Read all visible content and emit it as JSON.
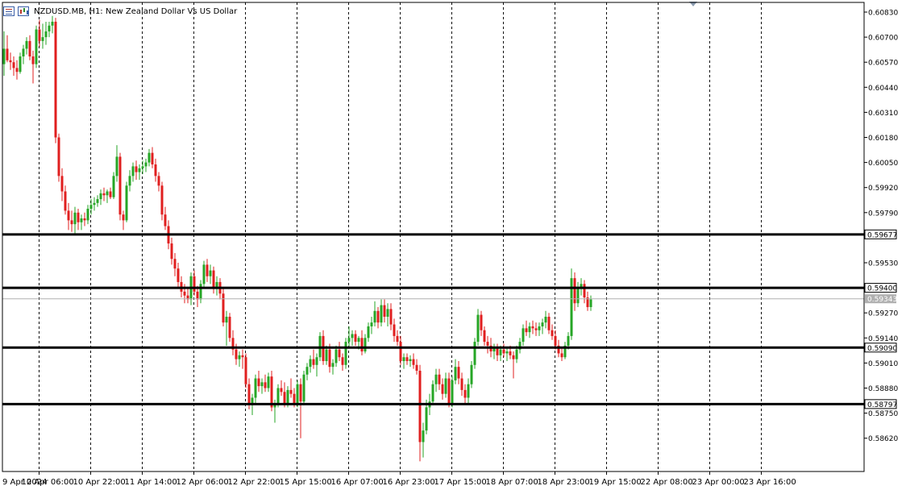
{
  "header": {
    "symbol_line": "NZDUSD.MB, H1:  New Zealand Dollar Vs US Dollar",
    "icons": [
      "list-icon",
      "chart-window-icon"
    ]
  },
  "chart_data": {
    "type": "candlestick",
    "symbol": "NZDUSD.MB",
    "timeframe": "H1",
    "title": "New Zealand Dollar Vs US Dollar",
    "ylim": [
      0.5855,
      0.6089
    ],
    "y_ticks": [
      "0.60830",
      "0.60700",
      "0.60570",
      "0.60440",
      "0.60310",
      "0.60180",
      "0.60050",
      "0.59920",
      "0.59790",
      "0.59530",
      "0.59270",
      "0.59140",
      "0.59010",
      "0.58880",
      "0.58750",
      "0.58620"
    ],
    "x_ticks": [
      "9 Apr 2024",
      "10 Apr 06:00",
      "10 Apr 22:00",
      "11 Apr 14:00",
      "12 Apr 06:00",
      "12 Apr 22:00",
      "15 Apr 15:00",
      "16 Apr 07:00",
      "16 Apr 23:00",
      "17 Apr 15:00",
      "18 Apr 07:00",
      "18 Apr 23:00",
      "19 Apr 15:00",
      "22 Apr 08:00",
      "23 Apr 00:00",
      "23 Apr 16:00"
    ],
    "grid": {
      "vertical_dashed": true,
      "horizontal": false
    },
    "current_price": {
      "value": 0.59343,
      "label": "0.59343"
    },
    "horizontal_levels": [
      {
        "value": 0.59677,
        "label": "0.59677"
      },
      {
        "value": 0.594,
        "label": "0.59400"
      },
      {
        "value": 0.5909,
        "label": "0.59090"
      },
      {
        "value": 0.58797,
        "label": "0.58797"
      }
    ],
    "colors": {
      "bull": "#26a626",
      "bear": "#e01f1f",
      "level": "#000000",
      "current": "#b0b0b0",
      "grid": "#000000"
    },
    "bars_per_tick": 16,
    "candles": [
      [
        0.6056,
        0.6073,
        0.605,
        0.6064
      ],
      [
        0.6064,
        0.6071,
        0.6057,
        0.6058
      ],
      [
        0.6058,
        0.6062,
        0.6053,
        0.6057
      ],
      [
        0.6057,
        0.606,
        0.605,
        0.6054
      ],
      [
        0.6054,
        0.6058,
        0.6048,
        0.6052
      ],
      [
        0.6052,
        0.6062,
        0.6051,
        0.606
      ],
      [
        0.606,
        0.6066,
        0.6056,
        0.6064
      ],
      [
        0.6064,
        0.607,
        0.6061,
        0.6068
      ],
      [
        0.6068,
        0.6071,
        0.6058,
        0.606
      ],
      [
        0.606,
        0.6063,
        0.6046,
        0.6056
      ],
      [
        0.6056,
        0.6076,
        0.6054,
        0.6074
      ],
      [
        0.6074,
        0.6079,
        0.6065,
        0.6068
      ],
      [
        0.6068,
        0.6077,
        0.6064,
        0.607
      ],
      [
        0.607,
        0.6078,
        0.6066,
        0.6073
      ],
      [
        0.6073,
        0.6078,
        0.607,
        0.6076
      ],
      [
        0.6076,
        0.6081,
        0.6072,
        0.6078
      ],
      [
        0.6078,
        0.608,
        0.6015,
        0.6018
      ],
      [
        0.6018,
        0.602,
        0.5995,
        0.5998
      ],
      [
        0.5998,
        0.6002,
        0.5985,
        0.599
      ],
      [
        0.599,
        0.5993,
        0.5978,
        0.598
      ],
      [
        0.598,
        0.5984,
        0.597,
        0.5975
      ],
      [
        0.5975,
        0.598,
        0.5969,
        0.5973
      ],
      [
        0.5973,
        0.5982,
        0.5968,
        0.5979
      ],
      [
        0.5979,
        0.5981,
        0.597,
        0.5974
      ],
      [
        0.5974,
        0.5978,
        0.597,
        0.5976
      ],
      [
        0.5976,
        0.5979,
        0.5972,
        0.5975
      ],
      [
        0.5975,
        0.5983,
        0.5973,
        0.5981
      ],
      [
        0.5981,
        0.5986,
        0.5978,
        0.5983
      ],
      [
        0.5983,
        0.5987,
        0.598,
        0.5984
      ],
      [
        0.5984,
        0.5988,
        0.5982,
        0.5986
      ],
      [
        0.5986,
        0.5991,
        0.5983,
        0.5989
      ],
      [
        0.5989,
        0.5992,
        0.5985,
        0.5988
      ],
      [
        0.5988,
        0.5991,
        0.5984,
        0.599
      ],
      [
        0.599,
        0.5992,
        0.5986,
        0.5987
      ],
      [
        0.5987,
        0.6,
        0.5986,
        0.5998
      ],
      [
        0.5998,
        0.6014,
        0.5995,
        0.6008
      ],
      [
        0.6008,
        0.601,
        0.5975,
        0.5978
      ],
      [
        0.5978,
        0.598,
        0.597,
        0.5975
      ],
      [
        0.5975,
        0.5995,
        0.5974,
        0.5993
      ],
      [
        0.5993,
        0.6001,
        0.599,
        0.5998
      ],
      [
        0.5998,
        0.6005,
        0.5995,
        0.6003
      ],
      [
        0.6003,
        0.6006,
        0.5996,
        0.6
      ],
      [
        0.6,
        0.6004,
        0.5996,
        0.6002
      ],
      [
        0.6002,
        0.6006,
        0.5999,
        0.6003
      ],
      [
        0.6003,
        0.6007,
        0.6,
        0.6005
      ],
      [
        0.6005,
        0.6012,
        0.6003,
        0.601
      ],
      [
        0.601,
        0.6013,
        0.6002,
        0.6004
      ],
      [
        0.6004,
        0.6007,
        0.5995,
        0.5998
      ],
      [
        0.5998,
        0.6,
        0.599,
        0.5993
      ],
      [
        0.5993,
        0.5995,
        0.5975,
        0.5978
      ],
      [
        0.5978,
        0.5982,
        0.597,
        0.5972
      ],
      [
        0.5972,
        0.5975,
        0.596,
        0.5963
      ],
      [
        0.5963,
        0.5966,
        0.5952,
        0.5955
      ],
      [
        0.5955,
        0.5958,
        0.5946,
        0.595
      ],
      [
        0.595,
        0.5953,
        0.594,
        0.5943
      ],
      [
        0.5943,
        0.5946,
        0.5935,
        0.5938
      ],
      [
        0.5938,
        0.5942,
        0.5932,
        0.5936
      ],
      [
        0.5936,
        0.594,
        0.5932,
        0.5934
      ],
      [
        0.5934,
        0.5948,
        0.5931,
        0.5946
      ],
      [
        0.5946,
        0.5949,
        0.5936,
        0.5938
      ],
      [
        0.5938,
        0.5941,
        0.593,
        0.5934
      ],
      [
        0.5934,
        0.5944,
        0.5932,
        0.5942
      ],
      [
        0.5942,
        0.5954,
        0.594,
        0.5952
      ],
      [
        0.5952,
        0.5955,
        0.5943,
        0.5946
      ],
      [
        0.5946,
        0.5952,
        0.5942,
        0.5949
      ],
      [
        0.5949,
        0.5951,
        0.5937,
        0.594
      ],
      [
        0.594,
        0.5946,
        0.5936,
        0.5943
      ],
      [
        0.5943,
        0.5945,
        0.5934,
        0.5937
      ],
      [
        0.5937,
        0.594,
        0.592,
        0.5922
      ],
      [
        0.5922,
        0.5928,
        0.591,
        0.5925
      ],
      [
        0.5925,
        0.5927,
        0.5912,
        0.5914
      ],
      [
        0.5914,
        0.5918,
        0.5905,
        0.5908
      ],
      [
        0.5908,
        0.5911,
        0.59,
        0.5903
      ],
      [
        0.5903,
        0.5907,
        0.5899,
        0.5905
      ],
      [
        0.5905,
        0.5908,
        0.5898,
        0.5904
      ],
      [
        0.5904,
        0.5906,
        0.5888,
        0.589
      ],
      [
        0.589,
        0.5893,
        0.5877,
        0.588
      ],
      [
        0.588,
        0.5885,
        0.5874,
        0.5883
      ],
      [
        0.5883,
        0.5895,
        0.588,
        0.5893
      ],
      [
        0.5893,
        0.5897,
        0.5886,
        0.5889
      ],
      [
        0.5889,
        0.5893,
        0.5885,
        0.5891
      ],
      [
        0.5891,
        0.5895,
        0.5886,
        0.5888
      ],
      [
        0.5888,
        0.5896,
        0.5886,
        0.5894
      ],
      [
        0.5894,
        0.5897,
        0.5876,
        0.5878
      ],
      [
        0.5878,
        0.5882,
        0.587,
        0.588
      ],
      [
        0.588,
        0.589,
        0.5878,
        0.5888
      ],
      [
        0.5888,
        0.5892,
        0.5884,
        0.5886
      ],
      [
        0.5886,
        0.5891,
        0.5878,
        0.588
      ],
      [
        0.588,
        0.5889,
        0.5878,
        0.5887
      ],
      [
        0.5887,
        0.5893,
        0.5883,
        0.5885
      ],
      [
        0.5885,
        0.5888,
        0.5878,
        0.588
      ],
      [
        0.588,
        0.5892,
        0.5878,
        0.589
      ],
      [
        0.589,
        0.5893,
        0.5862,
        0.5881
      ],
      [
        0.5881,
        0.5897,
        0.5879,
        0.5895
      ],
      [
        0.5895,
        0.5901,
        0.5892,
        0.5899
      ],
      [
        0.5899,
        0.5905,
        0.5896,
        0.5903
      ],
      [
        0.5903,
        0.5908,
        0.5898,
        0.59
      ],
      [
        0.59,
        0.5906,
        0.5894,
        0.5904
      ],
      [
        0.5904,
        0.5917,
        0.5902,
        0.5915
      ],
      [
        0.5915,
        0.5918,
        0.59,
        0.5902
      ],
      [
        0.5902,
        0.591,
        0.59,
        0.5908
      ],
      [
        0.5908,
        0.5911,
        0.5896,
        0.5899
      ],
      [
        0.5899,
        0.5903,
        0.5895,
        0.5901
      ],
      [
        0.5901,
        0.591,
        0.5899,
        0.5908
      ],
      [
        0.5908,
        0.5912,
        0.5902,
        0.5904
      ],
      [
        0.5904,
        0.5906,
        0.5897,
        0.59
      ],
      [
        0.59,
        0.5914,
        0.5898,
        0.5912
      ],
      [
        0.5912,
        0.592,
        0.5909,
        0.5914
      ],
      [
        0.5914,
        0.5918,
        0.591,
        0.5916
      ],
      [
        0.5916,
        0.5918,
        0.591,
        0.5912
      ],
      [
        0.5912,
        0.5915,
        0.5908,
        0.5914
      ],
      [
        0.5914,
        0.5918,
        0.5905,
        0.5907
      ],
      [
        0.5907,
        0.5916,
        0.5906,
        0.5914
      ],
      [
        0.5914,
        0.5922,
        0.5912,
        0.592
      ],
      [
        0.592,
        0.5925,
        0.5916,
        0.5922
      ],
      [
        0.5922,
        0.5933,
        0.592,
        0.5928
      ],
      [
        0.5928,
        0.593,
        0.5919,
        0.5922
      ],
      [
        0.5922,
        0.5934,
        0.592,
        0.5931
      ],
      [
        0.5931,
        0.5934,
        0.5922,
        0.5925
      ],
      [
        0.5925,
        0.5932,
        0.592,
        0.5929
      ],
      [
        0.5929,
        0.5932,
        0.5918,
        0.5921
      ],
      [
        0.5921,
        0.5924,
        0.5912,
        0.5915
      ],
      [
        0.5915,
        0.5918,
        0.591,
        0.5912
      ],
      [
        0.5912,
        0.5915,
        0.59,
        0.5902
      ],
      [
        0.5902,
        0.5906,
        0.5898,
        0.5904
      ],
      [
        0.5904,
        0.5906,
        0.59,
        0.5902
      ],
      [
        0.5902,
        0.5905,
        0.5899,
        0.5903
      ],
      [
        0.5903,
        0.5906,
        0.5898,
        0.59
      ],
      [
        0.59,
        0.5903,
        0.5895,
        0.5897
      ],
      [
        0.5897,
        0.59,
        0.585,
        0.586
      ],
      [
        0.586,
        0.587,
        0.5852,
        0.5866
      ],
      [
        0.5866,
        0.5882,
        0.5864,
        0.5878
      ],
      [
        0.5878,
        0.5885,
        0.5874,
        0.5881
      ],
      [
        0.5881,
        0.5892,
        0.5879,
        0.589
      ],
      [
        0.589,
        0.5898,
        0.5886,
        0.5895
      ],
      [
        0.5895,
        0.5898,
        0.5887,
        0.589
      ],
      [
        0.589,
        0.5893,
        0.5882,
        0.5885
      ],
      [
        0.5885,
        0.5896,
        0.5883,
        0.5893
      ],
      [
        0.5893,
        0.5896,
        0.5878,
        0.588
      ],
      [
        0.588,
        0.5894,
        0.5878,
        0.5892
      ],
      [
        0.5892,
        0.5903,
        0.589,
        0.5899
      ],
      [
        0.5899,
        0.5902,
        0.589,
        0.5893
      ],
      [
        0.5893,
        0.5896,
        0.5884,
        0.5887
      ],
      [
        0.5887,
        0.589,
        0.588,
        0.5883
      ],
      [
        0.5883,
        0.5893,
        0.588,
        0.589
      ],
      [
        0.589,
        0.5902,
        0.5888,
        0.59
      ],
      [
        0.59,
        0.5914,
        0.5898,
        0.5912
      ],
      [
        0.5912,
        0.5929,
        0.591,
        0.5926
      ],
      [
        0.5926,
        0.5928,
        0.5915,
        0.5918
      ],
      [
        0.5918,
        0.592,
        0.591,
        0.5912
      ],
      [
        0.5912,
        0.5915,
        0.5906,
        0.591
      ],
      [
        0.591,
        0.5914,
        0.5904,
        0.5907
      ],
      [
        0.5907,
        0.5911,
        0.5903,
        0.5909
      ],
      [
        0.5909,
        0.5911,
        0.5902,
        0.5905
      ],
      [
        0.5905,
        0.591,
        0.5902,
        0.5908
      ],
      [
        0.5908,
        0.5911,
        0.5904,
        0.5906
      ],
      [
        0.5906,
        0.5909,
        0.5902,
        0.5907
      ],
      [
        0.5907,
        0.591,
        0.5903,
        0.5905
      ],
      [
        0.5905,
        0.5907,
        0.5893,
        0.5903
      ],
      [
        0.5903,
        0.591,
        0.5901,
        0.5908
      ],
      [
        0.5908,
        0.5914,
        0.5906,
        0.5912
      ],
      [
        0.5912,
        0.5921,
        0.591,
        0.5919
      ],
      [
        0.5919,
        0.5923,
        0.5915,
        0.5917
      ],
      [
        0.5917,
        0.5922,
        0.5914,
        0.592
      ],
      [
        0.592,
        0.5923,
        0.5916,
        0.5919
      ],
      [
        0.5919,
        0.5922,
        0.5915,
        0.5918
      ],
      [
        0.5918,
        0.5922,
        0.5915,
        0.592
      ],
      [
        0.592,
        0.5924,
        0.5916,
        0.5922
      ],
      [
        0.5922,
        0.5928,
        0.5919,
        0.5925
      ],
      [
        0.5925,
        0.5927,
        0.5916,
        0.5918
      ],
      [
        0.5918,
        0.5921,
        0.5913,
        0.5915
      ],
      [
        0.5915,
        0.5918,
        0.5908,
        0.591
      ],
      [
        0.591,
        0.5913,
        0.5904,
        0.5906
      ],
      [
        0.5906,
        0.5909,
        0.5902,
        0.5904
      ],
      [
        0.5904,
        0.5912,
        0.5903,
        0.591
      ],
      [
        0.591,
        0.5917,
        0.5908,
        0.5915
      ],
      [
        0.5915,
        0.595,
        0.5913,
        0.5945
      ],
      [
        0.5945,
        0.5948,
        0.5928,
        0.5932
      ],
      [
        0.5932,
        0.5943,
        0.593,
        0.594
      ],
      [
        0.594,
        0.5945,
        0.5936,
        0.5942
      ],
      [
        0.5942,
        0.5944,
        0.5932,
        0.5935
      ],
      [
        0.5935,
        0.5938,
        0.5928,
        0.593
      ],
      [
        0.593,
        0.5936,
        0.5928,
        0.5934
      ]
    ]
  }
}
